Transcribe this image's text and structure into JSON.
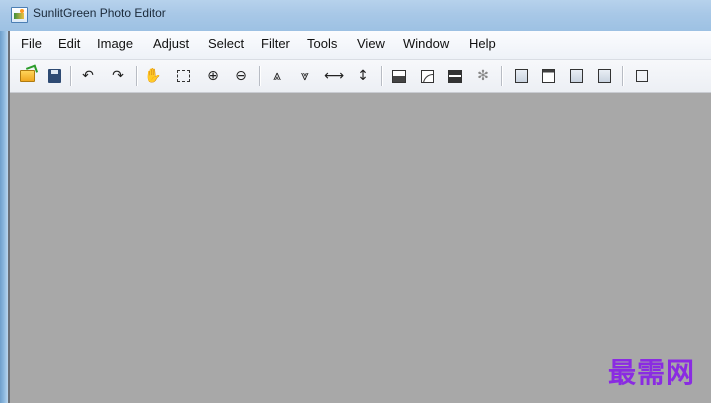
{
  "window": {
    "title": "SunlitGreen Photo Editor"
  },
  "menu": [
    "File",
    "Edit",
    "Image",
    "Adjust",
    "Select",
    "Filter",
    "Tools",
    "View",
    "Window",
    "Help"
  ],
  "toolbar": {
    "open": "open-folder-icon",
    "save": "save-icon",
    "undo_glyph": "↶",
    "redo_glyph": "↷",
    "hand_glyph": "✋",
    "zoom_in_glyph": "⊕",
    "zoom_out_glyph": "⊖",
    "flip_a_glyph": "⩓",
    "flip_b_glyph": "⩔",
    "horizontal_glyph": "⟷",
    "vertical_glyph": "↕",
    "brightness_glyph": "✻"
  },
  "watermark": "最需网",
  "colors": {
    "canvas": "#a8a8a8",
    "titlebar": "#a8c8e7",
    "watermark": "#8a2be2"
  }
}
